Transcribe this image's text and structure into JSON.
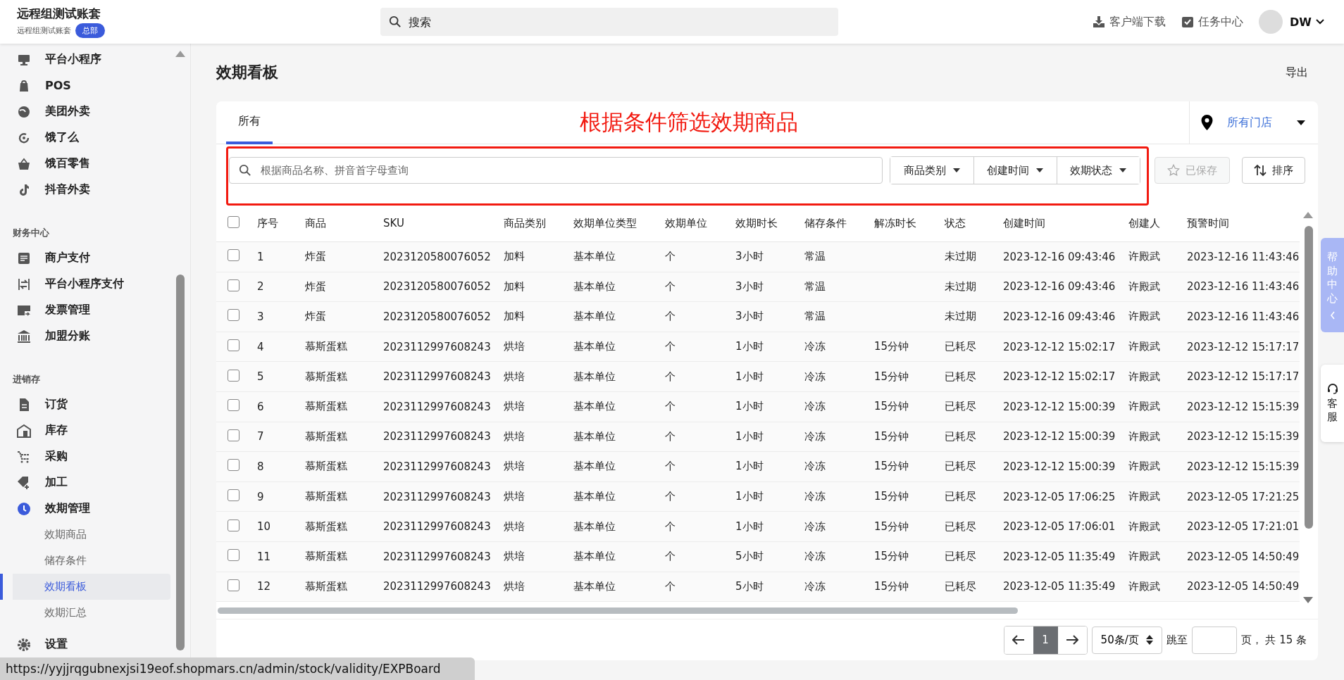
{
  "header": {
    "brand": "远程组测试账套",
    "account": "远程组测试账套",
    "badge": "总部",
    "search": {
      "placeholder": "搜索"
    },
    "actions": [
      "客户端下载",
      "任务中心"
    ],
    "user": "DW"
  },
  "sidebar": {
    "sections": [
      {
        "items": [
          {
            "label": "平台小程序"
          },
          {
            "label": "POS"
          },
          {
            "label": "美团外卖"
          },
          {
            "label": "饿了么"
          },
          {
            "label": "饿百零售"
          },
          {
            "label": "抖音外卖"
          }
        ]
      },
      {
        "title": "财务中心",
        "items": [
          {
            "label": "商户支付"
          },
          {
            "label": "平台小程序支付"
          },
          {
            "label": "发票管理"
          },
          {
            "label": "加盟分账"
          }
        ]
      },
      {
        "title": "进销存",
        "items": [
          {
            "label": "订货"
          },
          {
            "label": "库存"
          },
          {
            "label": "采购"
          },
          {
            "label": "加工"
          },
          {
            "label": "效期管理",
            "expanded": true,
            "children": [
              {
                "label": "效期商品",
                "selected": false
              },
              {
                "label": "储存条件",
                "selected": false
              },
              {
                "label": "效期看板",
                "selected": true
              },
              {
                "label": "效期汇总",
                "selected": false
              }
            ]
          }
        ]
      },
      {
        "items": [
          {
            "label": "设置"
          }
        ]
      }
    ]
  },
  "page": {
    "title": "效期看板",
    "export": "导出"
  },
  "tabs": [
    {
      "label": "所有",
      "selected": true
    }
  ],
  "annotation": "根据条件筛选效期商品",
  "store_selector": "所有门店",
  "filters": {
    "search": {
      "placeholder": "根据商品名称、拼音首字母查询"
    },
    "dropdowns": [
      "商品类别",
      "创建时间",
      "效期状态"
    ],
    "saved": {
      "label": "已保存",
      "disabled": true
    },
    "sort": "排序"
  },
  "table": {
    "header_checked": false,
    "columns": [
      "序号",
      "商品",
      "SKU",
      "商品类别",
      "效期单位类型",
      "效期单位",
      "效期时长",
      "储存条件",
      "解冻时长",
      "状态",
      "创建时间",
      "创建人",
      "预警时间"
    ],
    "rows": [
      {
        "checked": false,
        "cells": [
          "1",
          "炸蛋",
          "2023120580076052",
          "加料",
          "基本单位",
          "个",
          "3小时",
          "常温",
          null,
          "未过期",
          "2023-12-16 09:43:46",
          "许殿武",
          "2023-12-16 11:43:46"
        ]
      },
      {
        "checked": false,
        "cells": [
          "2",
          "炸蛋",
          "2023120580076052",
          "加料",
          "基本单位",
          "个",
          "3小时",
          "常温",
          null,
          "未过期",
          "2023-12-16 09:43:46",
          "许殿武",
          "2023-12-16 11:43:46"
        ]
      },
      {
        "checked": false,
        "cells": [
          "3",
          "炸蛋",
          "2023120580076052",
          "加料",
          "基本单位",
          "个",
          "3小时",
          "常温",
          null,
          "未过期",
          "2023-12-16 09:43:46",
          "许殿武",
          "2023-12-16 11:43:46"
        ]
      },
      {
        "checked": false,
        "cells": [
          "4",
          "慕斯蛋糕",
          "2023112997608243",
          "烘培",
          "基本单位",
          "个",
          "1小时",
          "冷冻",
          "15分钟",
          "已耗尽",
          "2023-12-12 15:02:17",
          "许殿武",
          "2023-12-12 15:17:17"
        ]
      },
      {
        "checked": false,
        "cells": [
          "5",
          "慕斯蛋糕",
          "2023112997608243",
          "烘培",
          "基本单位",
          "个",
          "1小时",
          "冷冻",
          "15分钟",
          "已耗尽",
          "2023-12-12 15:02:17",
          "许殿武",
          "2023-12-12 15:17:17"
        ]
      },
      {
        "checked": false,
        "cells": [
          "6",
          "慕斯蛋糕",
          "2023112997608243",
          "烘培",
          "基本单位",
          "个",
          "1小时",
          "冷冻",
          "15分钟",
          "已耗尽",
          "2023-12-12 15:00:39",
          "许殿武",
          "2023-12-12 15:15:39"
        ]
      },
      {
        "checked": false,
        "cells": [
          "7",
          "慕斯蛋糕",
          "2023112997608243",
          "烘培",
          "基本单位",
          "个",
          "1小时",
          "冷冻",
          "15分钟",
          "已耗尽",
          "2023-12-12 15:00:39",
          "许殿武",
          "2023-12-12 15:15:39"
        ]
      },
      {
        "checked": false,
        "cells": [
          "8",
          "慕斯蛋糕",
          "2023112997608243",
          "烘培",
          "基本单位",
          "个",
          "1小时",
          "冷冻",
          "15分钟",
          "已耗尽",
          "2023-12-12 15:00:39",
          "许殿武",
          "2023-12-12 15:15:39"
        ]
      },
      {
        "checked": false,
        "cells": [
          "9",
          "慕斯蛋糕",
          "2023112997608243",
          "烘培",
          "基本单位",
          "个",
          "1小时",
          "冷冻",
          "15分钟",
          "已耗尽",
          "2023-12-05 17:06:25",
          "许殿武",
          "2023-12-05 17:21:25"
        ]
      },
      {
        "checked": false,
        "cells": [
          "10",
          "慕斯蛋糕",
          "2023112997608243",
          "烘培",
          "基本单位",
          "个",
          "1小时",
          "冷冻",
          "15分钟",
          "已耗尽",
          "2023-12-05 17:06:01",
          "许殿武",
          "2023-12-05 17:21:01"
        ]
      },
      {
        "checked": false,
        "cells": [
          "11",
          "慕斯蛋糕",
          "2023112997608243",
          "烘培",
          "基本单位",
          "个",
          "5小时",
          "冷冻",
          "15分钟",
          "已耗尽",
          "2023-12-05 11:35:49",
          "许殿武",
          "2023-12-05 14:50:49"
        ]
      },
      {
        "checked": false,
        "cells": [
          "12",
          "慕斯蛋糕",
          "2023112997608243",
          "烘培",
          "基本单位",
          "个",
          "5小时",
          "冷冻",
          "15分钟",
          "已耗尽",
          "2023-12-05 11:35:49",
          "许殿武",
          "2023-12-05 14:50:49"
        ]
      }
    ]
  },
  "pagination": {
    "pages": [
      {
        "label": "1",
        "selected": true
      }
    ],
    "page_size": "50条/页",
    "jump_label": "跳至",
    "total": "页， 共 15 条"
  },
  "help": {
    "help_center": "帮助中心",
    "service": "客服"
  },
  "status_url": "https://yyjjrqgubnexjsi19eof.shopmars.cn/admin/stock/validity/EXPBoard"
}
